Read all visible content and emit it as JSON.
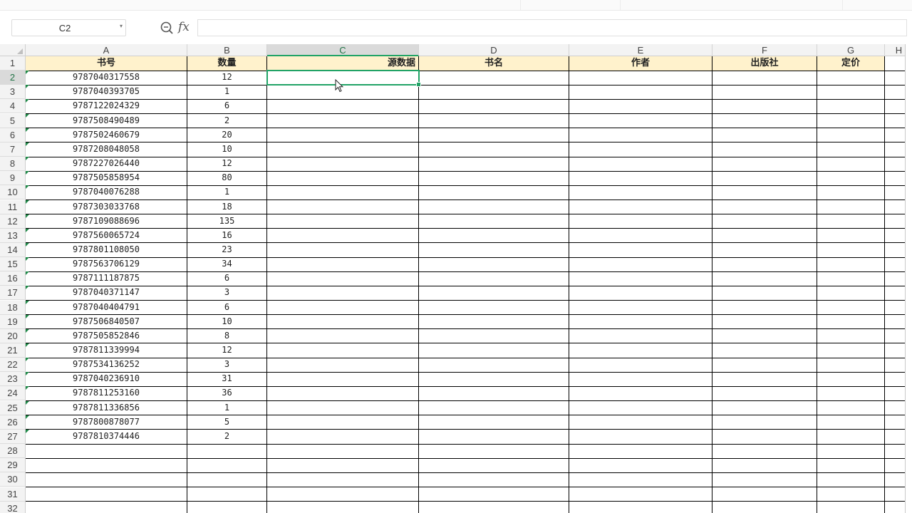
{
  "name_box": {
    "value": "C2"
  },
  "formula_bar": {
    "fx_label": "fx",
    "value": ""
  },
  "columns": [
    {
      "letter": "A",
      "header": "书号"
    },
    {
      "letter": "B",
      "header": "数量"
    },
    {
      "letter": "C",
      "header": "源数据"
    },
    {
      "letter": "D",
      "header": "书名"
    },
    {
      "letter": "E",
      "header": "作者"
    },
    {
      "letter": "F",
      "header": "出版社"
    },
    {
      "letter": "G",
      "header": "定价"
    },
    {
      "letter": "H",
      "header": ""
    }
  ],
  "rows": [
    {
      "isbn": "9787040317558",
      "qty": "12"
    },
    {
      "isbn": "9787040393705",
      "qty": "1"
    },
    {
      "isbn": "9787122024329",
      "qty": "6"
    },
    {
      "isbn": "9787508490489",
      "qty": "2"
    },
    {
      "isbn": "9787502460679",
      "qty": "20"
    },
    {
      "isbn": "9787208048058",
      "qty": "10"
    },
    {
      "isbn": "9787227026440",
      "qty": "12"
    },
    {
      "isbn": "9787505858954",
      "qty": "80"
    },
    {
      "isbn": "9787040076288",
      "qty": "1"
    },
    {
      "isbn": "9787303033768",
      "qty": "18"
    },
    {
      "isbn": "9787109088696",
      "qty": "135"
    },
    {
      "isbn": "9787560065724",
      "qty": "16"
    },
    {
      "isbn": "9787801108050",
      "qty": "23"
    },
    {
      "isbn": "9787563706129",
      "qty": "34"
    },
    {
      "isbn": "9787111187875",
      "qty": "6"
    },
    {
      "isbn": "9787040371147",
      "qty": "3"
    },
    {
      "isbn": "9787040404791",
      "qty": "6"
    },
    {
      "isbn": "9787506840507",
      "qty": "10"
    },
    {
      "isbn": "9787505852846",
      "qty": "8"
    },
    {
      "isbn": "9787811339994",
      "qty": "12"
    },
    {
      "isbn": "9787534136252",
      "qty": "3"
    },
    {
      "isbn": "9787040236910",
      "qty": "31"
    },
    {
      "isbn": "9787811253160",
      "qty": "36"
    },
    {
      "isbn": "9787811336856",
      "qty": "1"
    },
    {
      "isbn": "9787800878077",
      "qty": "5"
    },
    {
      "isbn": "9787810374446",
      "qty": "2"
    }
  ],
  "row_numbers": [
    "1",
    "2",
    "3",
    "4",
    "5",
    "6",
    "7",
    "8",
    "9",
    "10",
    "11",
    "12",
    "13",
    "14",
    "15",
    "16",
    "17",
    "18",
    "19",
    "20",
    "21",
    "22",
    "23",
    "24",
    "25",
    "26",
    "27",
    "28",
    "29",
    "30",
    "31",
    "32"
  ],
  "selection": {
    "cell": "C2",
    "active_column": "C",
    "active_row": "2"
  },
  "colors": {
    "header_fill": "#fff2cc",
    "selection": "#21a366",
    "error_triangle": "#1e8a48"
  },
  "icons": [
    "zoom-formula-icon",
    "fx-icon",
    "namebox-dropdown-icon",
    "mouse-pointer-icon"
  ]
}
